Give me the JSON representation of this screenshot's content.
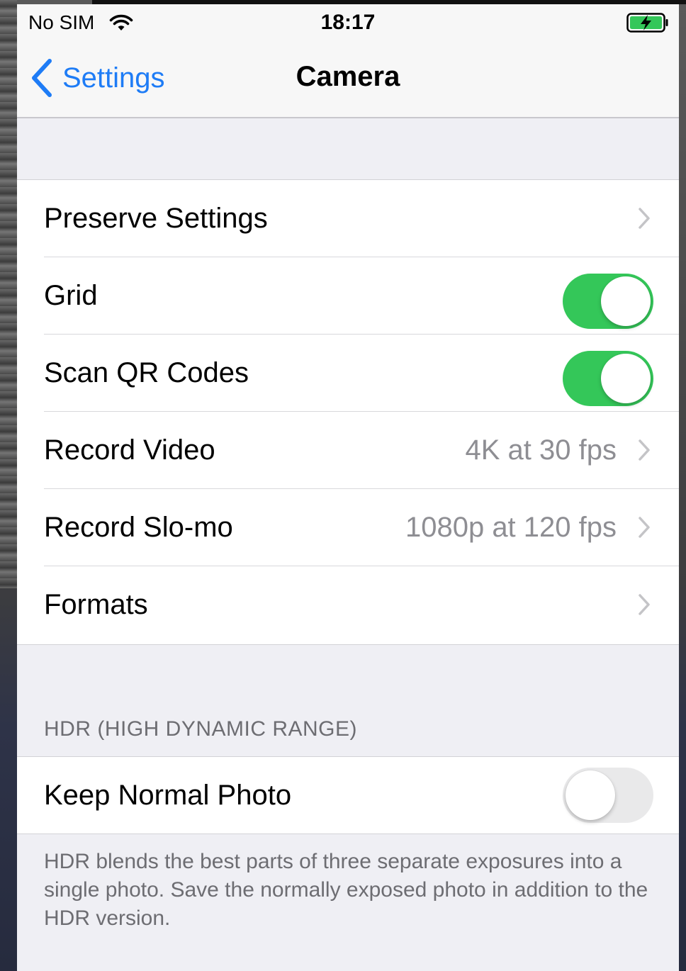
{
  "status_bar": {
    "carrier": "No SIM",
    "time": "18:17",
    "wifi_icon": "wifi-icon",
    "battery_icon": "battery-charging-icon"
  },
  "nav": {
    "back_label": "Settings",
    "title": "Camera"
  },
  "rows": [
    {
      "label": "Preserve Settings",
      "value": "",
      "accessory": "chevron"
    },
    {
      "label": "Grid",
      "value": "",
      "accessory": "toggle",
      "on": true
    },
    {
      "label": "Scan QR Codes",
      "value": "",
      "accessory": "toggle",
      "on": true
    },
    {
      "label": "Record Video",
      "value": "4K at 30 fps",
      "accessory": "chevron"
    },
    {
      "label": "Record Slo-mo",
      "value": "1080p at 120 fps",
      "accessory": "chevron"
    },
    {
      "label": "Formats",
      "value": "",
      "accessory": "chevron"
    }
  ],
  "hdr": {
    "header": "HDR (HIGH DYNAMIC RANGE)",
    "row_label": "Keep Normal Photo",
    "row_on": false,
    "footer": "HDR blends the best parts of three separate exposures into a single photo. Save the normally exposed photo in addition to the HDR version."
  },
  "colors": {
    "accent": "#1e7cf6",
    "toggle_on": "#34c759",
    "toggle_off": "#e9e9ea",
    "background": "#efeff4"
  }
}
